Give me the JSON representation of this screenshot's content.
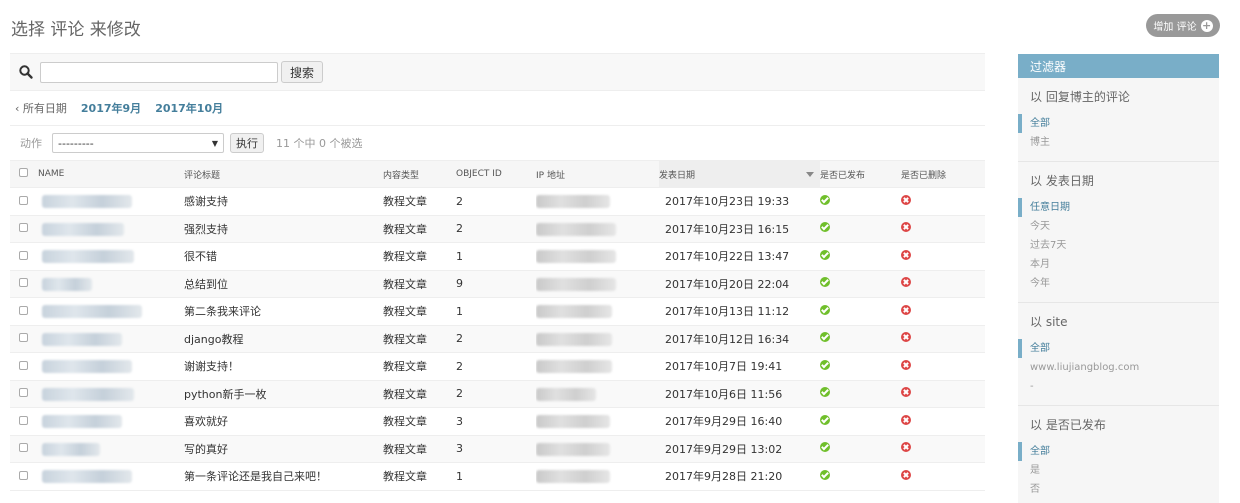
{
  "page": {
    "title": "选择 评论 来修改"
  },
  "toolbar": {
    "add_label": "增加 评论",
    "add_icon": "plus-icon"
  },
  "search": {
    "button_label": "搜索",
    "value": ""
  },
  "date_hierarchy": {
    "all_label": "‹ 所有日期",
    "links": [
      "2017年9月",
      "2017年10月"
    ]
  },
  "actions": {
    "label": "动作",
    "selected": "---------",
    "go_label": "执行",
    "count_text": "11 个中 0 个被选"
  },
  "table": {
    "columns": [
      "NAME",
      "评论标题",
      "内容类型",
      "OBJECT ID",
      "IP 地址",
      "发表日期",
      "是否已发布",
      "是否已删除"
    ],
    "sorted_column": "发表日期",
    "rows": [
      {
        "title": "感谢支持",
        "type": "教程文章",
        "object_id": "2",
        "date": "2017年10月23日 19:33",
        "published": true,
        "deleted": false
      },
      {
        "title": "强烈支持",
        "type": "教程文章",
        "object_id": "2",
        "date": "2017年10月23日 16:15",
        "published": true,
        "deleted": false
      },
      {
        "title": "很不错",
        "type": "教程文章",
        "object_id": "1",
        "date": "2017年10月22日 13:47",
        "published": true,
        "deleted": false
      },
      {
        "title": "总结到位",
        "type": "教程文章",
        "object_id": "9",
        "date": "2017年10月20日 22:04",
        "published": true,
        "deleted": false
      },
      {
        "title": "第二条我来评论",
        "type": "教程文章",
        "object_id": "1",
        "date": "2017年10月13日 11:12",
        "published": true,
        "deleted": false
      },
      {
        "title": "django教程",
        "type": "教程文章",
        "object_id": "2",
        "date": "2017年10月12日 16:34",
        "published": true,
        "deleted": false
      },
      {
        "title": "谢谢支持！",
        "type": "教程文章",
        "object_id": "2",
        "date": "2017年10月7日 19:41",
        "published": true,
        "deleted": false
      },
      {
        "title": "python新手一枚",
        "type": "教程文章",
        "object_id": "2",
        "date": "2017年10月6日 11:56",
        "published": true,
        "deleted": false
      },
      {
        "title": "喜欢就好",
        "type": "教程文章",
        "object_id": "3",
        "date": "2017年9月29日 16:40",
        "published": true,
        "deleted": false
      },
      {
        "title": "写的真好",
        "type": "教程文章",
        "object_id": "3",
        "date": "2017年9月29日 13:02",
        "published": true,
        "deleted": false
      },
      {
        "title": "第一条评论还是我自己来吧！",
        "type": "教程文章",
        "object_id": "1",
        "date": "2017年9月28日 21:20",
        "published": true,
        "deleted": false
      }
    ]
  },
  "filter": {
    "title": "过滤器",
    "groups": [
      {
        "heading": "以 回复博主的评论",
        "options": [
          "全部",
          "博主"
        ],
        "selected": 0
      },
      {
        "heading": "以 发表日期",
        "options": [
          "任意日期",
          "今天",
          "过去7天",
          "本月",
          "今年"
        ],
        "selected": 0
      },
      {
        "heading": "以 site",
        "options": [
          "全部",
          "www.liujiangblog.com",
          "-"
        ],
        "selected": 0
      },
      {
        "heading": "以 是否已发布",
        "options": [
          "全部",
          "是",
          "否"
        ],
        "selected": 0
      }
    ]
  },
  "colors": {
    "accent": "#79aec8",
    "link": "#447e9b",
    "published": "#70bf2b",
    "deleted": "#dd4646"
  }
}
